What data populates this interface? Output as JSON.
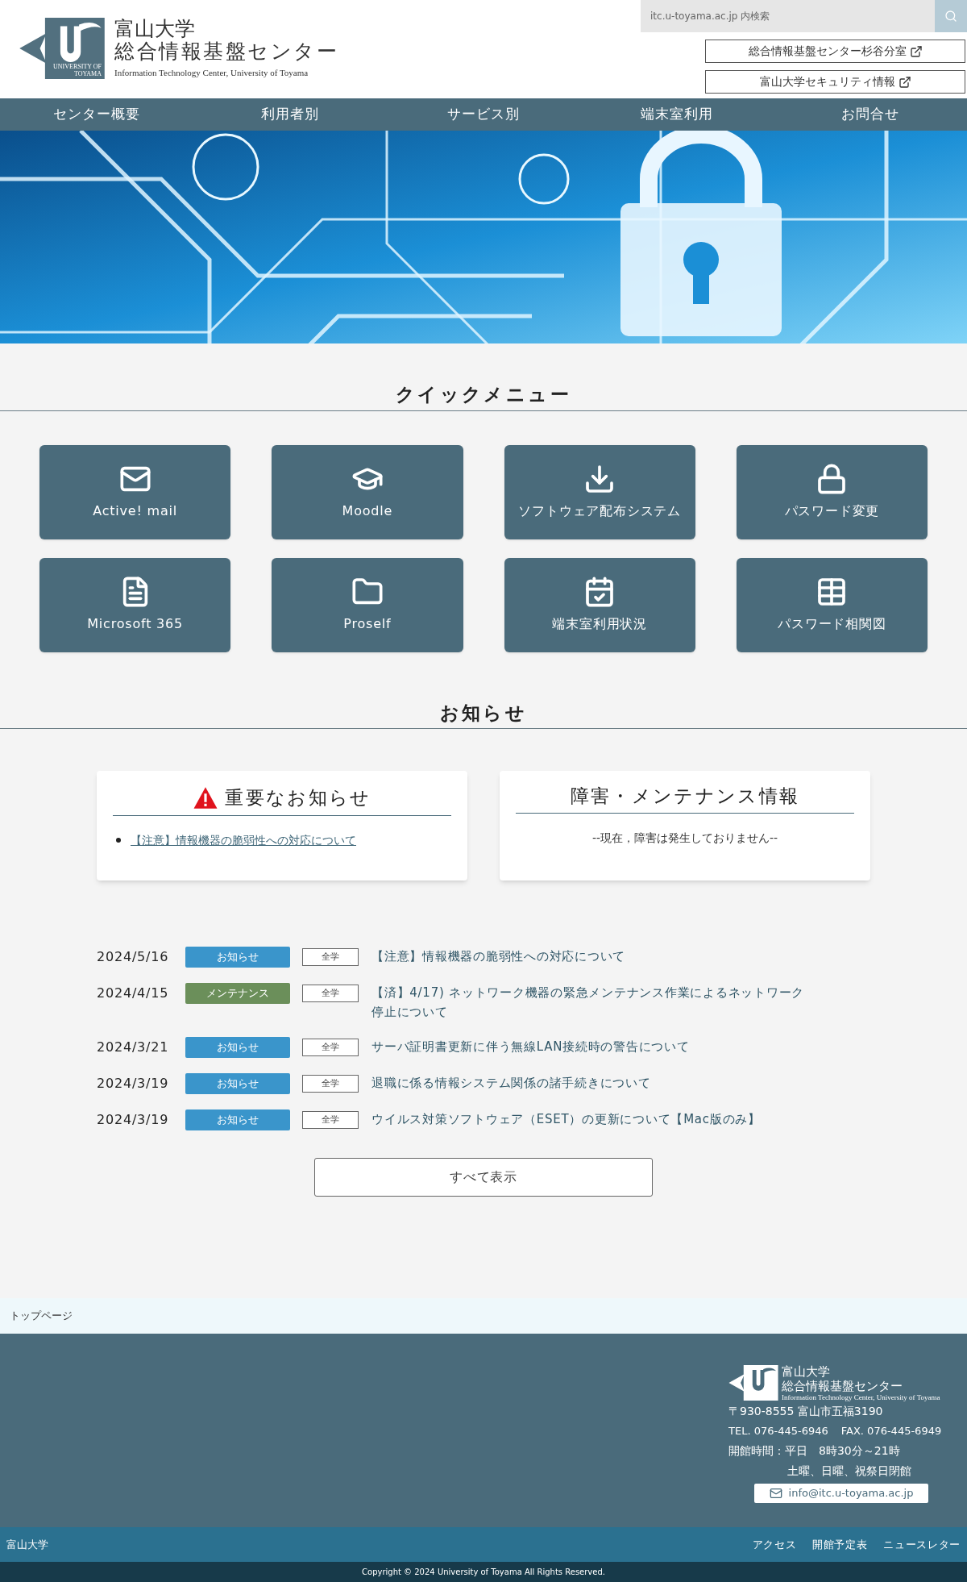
{
  "header": {
    "logo_text": "UNIVERSITY OF TOYAMA",
    "title_line1": "富山大学",
    "title_line2": "総合情報基盤センター",
    "subtitle": "Information Technology Center, University of Toyama",
    "search": {
      "placeholder": "itc.u-toyama.ac.jp 内検索"
    },
    "links": [
      "総合情報基盤センター杉谷分室",
      "富山大学セキュリティ情報"
    ]
  },
  "nav": [
    "センター概要",
    "利用者別",
    "サービス別",
    "端末室利用",
    "お問合せ"
  ],
  "quick_menu": {
    "title": "クイックメニュー",
    "items": [
      {
        "label": "Active! mail",
        "kind": "mail"
      },
      {
        "label": "Moodle",
        "kind": "cap"
      },
      {
        "label": "ソフトウェア配布システム",
        "kind": "download"
      },
      {
        "label": "パスワード変更",
        "kind": "lock"
      },
      {
        "label": "Microsoft 365",
        "kind": "file"
      },
      {
        "label": "Proself",
        "kind": "folder"
      },
      {
        "label": "端末室利用状況",
        "kind": "calendar"
      },
      {
        "label": "パスワード相関図",
        "kind": "table"
      }
    ]
  },
  "notices": {
    "title": "お知らせ",
    "important": {
      "title": "重要なお知らせ",
      "items": [
        "【注意】情報機器の脆弱性への対応について"
      ]
    },
    "maintenance": {
      "title": "障害・メンテナンス情報",
      "message": "--現在，障害は発生しておりません--"
    },
    "news": [
      {
        "date": "2024/5/16",
        "category": {
          "label": "お知らせ",
          "color": "#3a95cb"
        },
        "scope": "全学",
        "title": "【注意】情報機器の脆弱性への対応について"
      },
      {
        "date": "2024/4/15",
        "category": {
          "label": "メンテナンス",
          "color": "#6b8f5a"
        },
        "scope": "全学",
        "title": "【済】4/17) ネットワーク機器の緊急メンテナンス作業によるネットワーク停止について"
      },
      {
        "date": "2024/3/21",
        "category": {
          "label": "お知らせ",
          "color": "#3a95cb"
        },
        "scope": "全学",
        "title": "サーバ証明書更新に伴う無線LAN接続時の警告について"
      },
      {
        "date": "2024/3/19",
        "category": {
          "label": "お知らせ",
          "color": "#3a95cb"
        },
        "scope": "全学",
        "title": "退職に係る情報システム関係の諸手続きについて"
      },
      {
        "date": "2024/3/19",
        "category": {
          "label": "お知らせ",
          "color": "#3a95cb"
        },
        "scope": "全学",
        "title": "ウイルス対策ソフトウェア（ESET）の更新について【Mac版のみ】"
      }
    ],
    "show_all": "すべて表示"
  },
  "breadcrumb": "トップページ",
  "footer": {
    "title_line1": "富山大学",
    "title_line2": "総合情報基盤センター",
    "subtitle": "Information Technology Center, University of Toyama",
    "address": "〒930-8555 富山市五福3190",
    "tel": "TEL. 076-445-6946",
    "fax": "FAX. 076-445-6949",
    "hours": "開館時間：平日　8時30分～21時",
    "closed": "土曜、日曜、祝祭日閉館",
    "email": "info@itc.u-toyama.ac.jp"
  },
  "bottom_bar": {
    "left": "富山大学",
    "links": [
      "アクセス",
      "開館予定表",
      "ニュースレター"
    ]
  },
  "copyright": "Copyright © 2024 University of Toyama All Rights Reserved."
}
